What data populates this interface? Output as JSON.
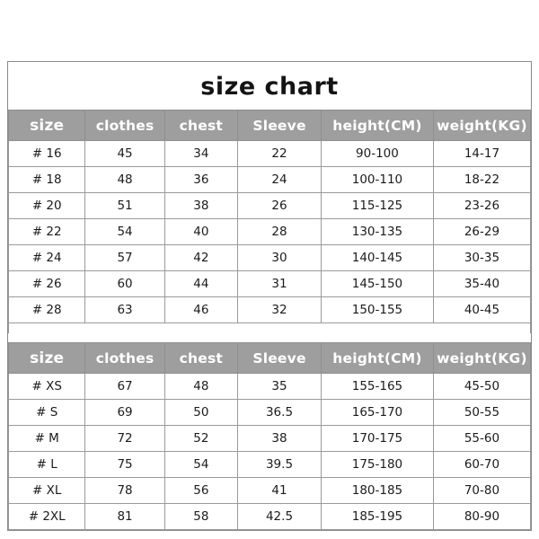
{
  "title": "size chart",
  "tables": [
    {
      "headers": [
        "size",
        "clothes",
        "chest",
        "Sleeve",
        "height(CM)",
        "weight(KG)"
      ],
      "rows": [
        [
          "# 16",
          "45",
          "34",
          "22",
          "90-100",
          "14-17"
        ],
        [
          "# 18",
          "48",
          "36",
          "24",
          "100-110",
          "18-22"
        ],
        [
          "# 20",
          "51",
          "38",
          "26",
          "115-125",
          "23-26"
        ],
        [
          "# 22",
          "54",
          "40",
          "28",
          "130-135",
          "26-29"
        ],
        [
          "# 24",
          "57",
          "42",
          "30",
          "140-145",
          "30-35"
        ],
        [
          "# 26",
          "60",
          "44",
          "31",
          "145-150",
          "35-40"
        ],
        [
          "# 28",
          "63",
          "46",
          "32",
          "150-155",
          "40-45"
        ]
      ]
    },
    {
      "headers": [
        "size",
        "clothes",
        "chest",
        "Sleeve",
        "height(CM)",
        "weight(KG)"
      ],
      "rows": [
        [
          "# XS",
          "67",
          "48",
          "35",
          "155-165",
          "45-50"
        ],
        [
          "# S",
          "69",
          "50",
          "36.5",
          "165-170",
          "50-55"
        ],
        [
          "# M",
          "72",
          "52",
          "38",
          "170-175",
          "55-60"
        ],
        [
          "# L",
          "75",
          "54",
          "39.5",
          "175-180",
          "60-70"
        ],
        [
          "# XL",
          "78",
          "56",
          "41",
          "180-185",
          "70-80"
        ],
        [
          "# 2XL",
          "81",
          "58",
          "42.5",
          "185-195",
          "80-90"
        ]
      ]
    }
  ],
  "colors": {
    "header_bg": "#9e9e9e",
    "header_text": "#ffffff",
    "border": "#9a9a9a",
    "page_bg": "#ffffff",
    "text": "#1b1b1b"
  }
}
